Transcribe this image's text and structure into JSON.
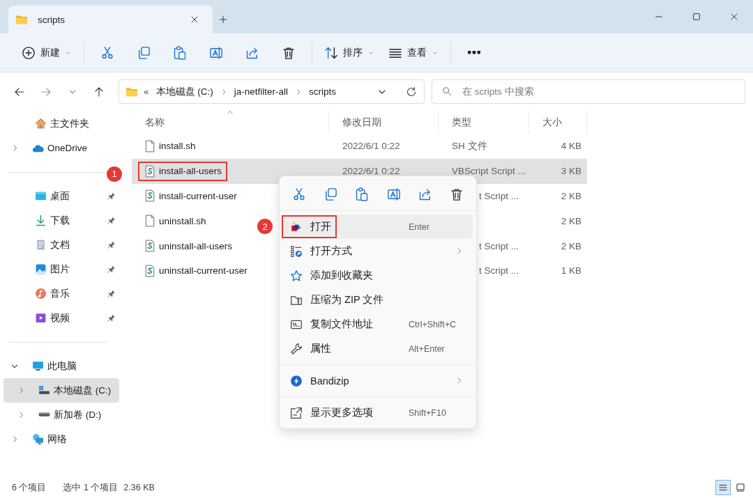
{
  "window": {
    "tab_title": "scripts"
  },
  "toolbar": {
    "groups": [
      {
        "items": [
          {
            "kind": "new",
            "label": "新建",
            "dropdown": true
          }
        ]
      },
      {
        "items": [
          {
            "kind": "cut"
          },
          {
            "kind": "copy"
          },
          {
            "kind": "paste"
          },
          {
            "kind": "rename"
          },
          {
            "kind": "share"
          },
          {
            "kind": "delete"
          }
        ]
      },
      {
        "items": [
          {
            "kind": "sort",
            "label": "排序",
            "dropdown": true
          },
          {
            "kind": "view",
            "label": "查看",
            "dropdown": true
          }
        ]
      },
      {
        "items": [
          {
            "kind": "more"
          }
        ]
      }
    ]
  },
  "address": {
    "prefix": "«",
    "path": [
      "本地磁盘 (C:)",
      "ja-netfilter-all",
      "scripts"
    ],
    "search_placeholder": "在 scripts 中搜索"
  },
  "sidebar": {
    "groups": [
      {
        "items": [
          {
            "kind": "home",
            "label": "主文件夹",
            "selected": false
          },
          {
            "kind": "cloud",
            "label": "OneDrive",
            "expanded": false,
            "selected": false
          }
        ]
      },
      {
        "items": [
          {
            "kind": "desktop",
            "label": "桌面",
            "pinned": true,
            "selected": false
          },
          {
            "kind": "download",
            "label": "下载",
            "pinned": true,
            "selected": false
          },
          {
            "kind": "documents",
            "label": "文档",
            "pinned": true,
            "selected": false
          },
          {
            "kind": "pictures",
            "label": "图片",
            "pinned": true,
            "selected": false
          },
          {
            "kind": "music",
            "label": "音乐",
            "pinned": true,
            "selected": false
          },
          {
            "kind": "videos",
            "label": "视频",
            "pinned": true,
            "selected": false
          }
        ]
      },
      {
        "items": [
          {
            "kind": "computer",
            "label": "此电脑",
            "expanded": true,
            "selected": false,
            "children": [
              {
                "kind": "drive-system",
                "label": "本地磁盘 (C:)",
                "expanded": false,
                "selected": true
              },
              {
                "kind": "drive",
                "label": "新加卷 (D:)",
                "expanded": false,
                "selected": false
              }
            ]
          },
          {
            "kind": "network",
            "label": "网络",
            "expanded": false,
            "selected": false
          }
        ]
      }
    ]
  },
  "file_list": {
    "columns": [
      {
        "label": "名称",
        "sorted": true
      },
      {
        "label": "修改日期",
        "sorted": false
      },
      {
        "label": "类型",
        "sorted": false
      },
      {
        "label": "大小",
        "sorted": false
      }
    ],
    "rows": [
      {
        "kind": "sh",
        "name": "install.sh",
        "date": "2022/6/1 0:22",
        "type": "SH 文件",
        "size": "4 KB",
        "selected": false,
        "marked": false
      },
      {
        "kind": "vbs",
        "name": "install-all-users",
        "date": "2022/6/1 0:22",
        "type": "VBScript Script ...",
        "size": "3 KB",
        "selected": true,
        "marked": true,
        "badge": "1"
      },
      {
        "kind": "vbs",
        "name": "install-current-user",
        "type_tail": "t Script ...",
        "size": "2 KB",
        "selected": false,
        "marked": false
      },
      {
        "kind": "sh",
        "name": "uninstall.sh",
        "size": "2 KB",
        "selected": false,
        "marked": false
      },
      {
        "kind": "vbs",
        "name": "uninstall-all-users",
        "type_tail": "t Script ...",
        "size": "2 KB",
        "selected": false,
        "marked": false
      },
      {
        "kind": "vbs",
        "name": "uninstall-current-user",
        "type_tail": "t Script ...",
        "size": "1 KB",
        "selected": false,
        "marked": false
      }
    ]
  },
  "context_menu": {
    "actions": [
      {
        "kind": "cut"
      },
      {
        "kind": "copy"
      },
      {
        "kind": "paste"
      },
      {
        "kind": "rename"
      },
      {
        "kind": "share"
      },
      {
        "kind": "delete"
      }
    ],
    "sections": [
      {
        "items": [
          {
            "kind": "open",
            "label": "打开",
            "shortcut": "Enter",
            "selected": true,
            "marked": true,
            "badge": "2"
          },
          {
            "kind": "open-with",
            "label": "打开方式",
            "submenu": true,
            "selected": false,
            "marked": false
          },
          {
            "kind": "favorite",
            "label": "添加到收藏夹",
            "selected": false,
            "marked": false
          },
          {
            "kind": "zip",
            "label": "压缩为 ZIP 文件",
            "selected": false,
            "marked": false
          },
          {
            "kind": "copy-path",
            "label": "复制文件地址",
            "shortcut": "Ctrl+Shift+C",
            "selected": false,
            "marked": false
          },
          {
            "kind": "properties",
            "label": "属性",
            "shortcut": "Alt+Enter",
            "selected": false,
            "marked": false
          }
        ]
      },
      {
        "items": [
          {
            "kind": "bandizip",
            "label": "Bandizip",
            "submenu": true,
            "selected": false,
            "marked": false
          }
        ]
      },
      {
        "items": [
          {
            "kind": "more-options",
            "label": "显示更多选项",
            "shortcut": "Shift+F10",
            "selected": false,
            "marked": false
          }
        ]
      }
    ]
  },
  "status_bar": {
    "item_count": "6 个项目",
    "selection": "选中 1 个项目",
    "selection_size": "2.36 KB",
    "views": [
      {
        "kind": "details",
        "selected": true
      },
      {
        "kind": "tiles",
        "selected": false
      }
    ]
  }
}
